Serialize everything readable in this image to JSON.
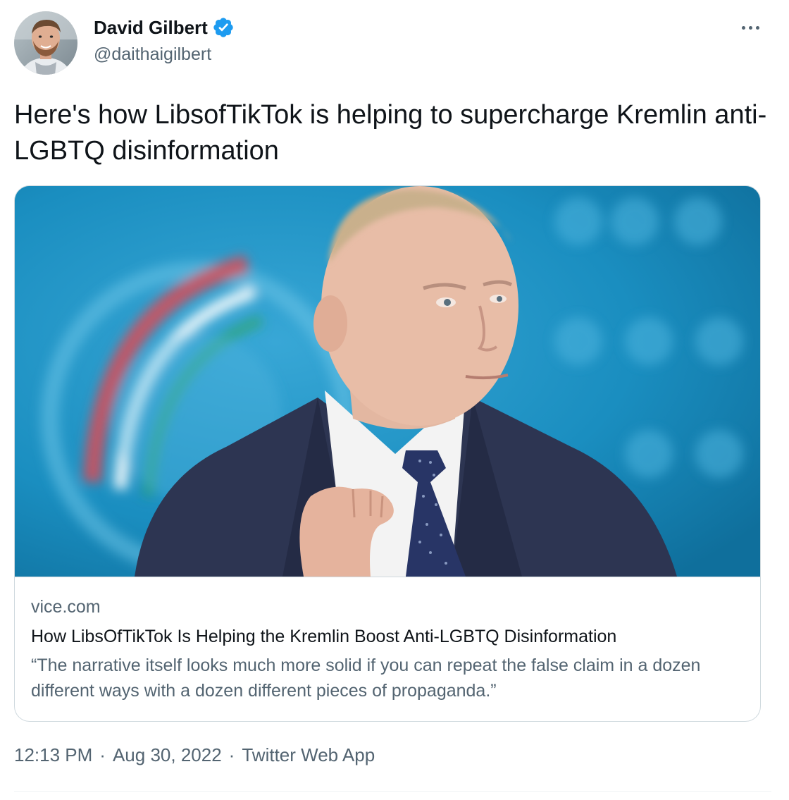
{
  "author": {
    "name": "David Gilbert",
    "handle": "@daithaigilbert",
    "verified": true,
    "verified_icon": "verified-badge-icon",
    "verified_color": "#1d9bf0"
  },
  "more_icon": "more-horizontal-icon",
  "tweet": {
    "text": "Here's how LibsofTikTok is helping to supercharge Kremlin anti-LGBTQ disinformation"
  },
  "card": {
    "domain": "vice.com",
    "title": "How LibsOfTikTok Is Helping the Kremlin Boost Anti-LGBTQ Disinformation",
    "description": "“The narrative itself looks much more solid if you can repeat the false claim in a dozen different ways with a dozen different pieces of propaganda.”"
  },
  "meta": {
    "time": "12:13 PM",
    "separator": "·",
    "date": "Aug 30, 2022",
    "source": "Twitter Web App"
  },
  "colors": {
    "text_primary": "#0f1419",
    "text_secondary": "#536471",
    "border": "#cfd9de",
    "accent": "#1d9bf0"
  }
}
